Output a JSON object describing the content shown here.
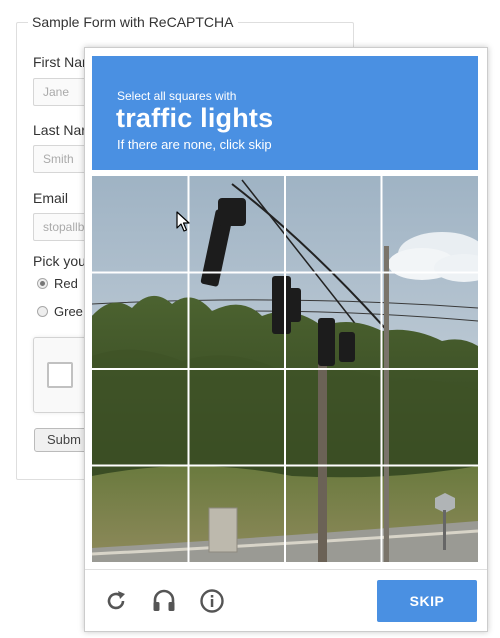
{
  "form": {
    "legend": "Sample Form with ReCAPTCHA",
    "first_name_label": "First Nar",
    "first_name_placeholder": "Jane",
    "last_name_label": "Last Nar",
    "last_name_placeholder": "Smith",
    "email_label": "Email",
    "email_placeholder": "stopallb",
    "pick_label": "Pick you",
    "radio_red": "Red",
    "radio_green": "Gree",
    "submit_label": "Subm"
  },
  "challenge": {
    "instruction": "Select all squares with",
    "target": "traffic lights",
    "hint": "If there are none, click skip",
    "grid_rows": 4,
    "grid_cols": 4,
    "skip_label": "SKIP"
  },
  "colors": {
    "accent": "#4a90e2"
  },
  "icons": [
    "reload-icon",
    "audio-icon",
    "info-icon",
    "pointer-cursor-icon"
  ]
}
